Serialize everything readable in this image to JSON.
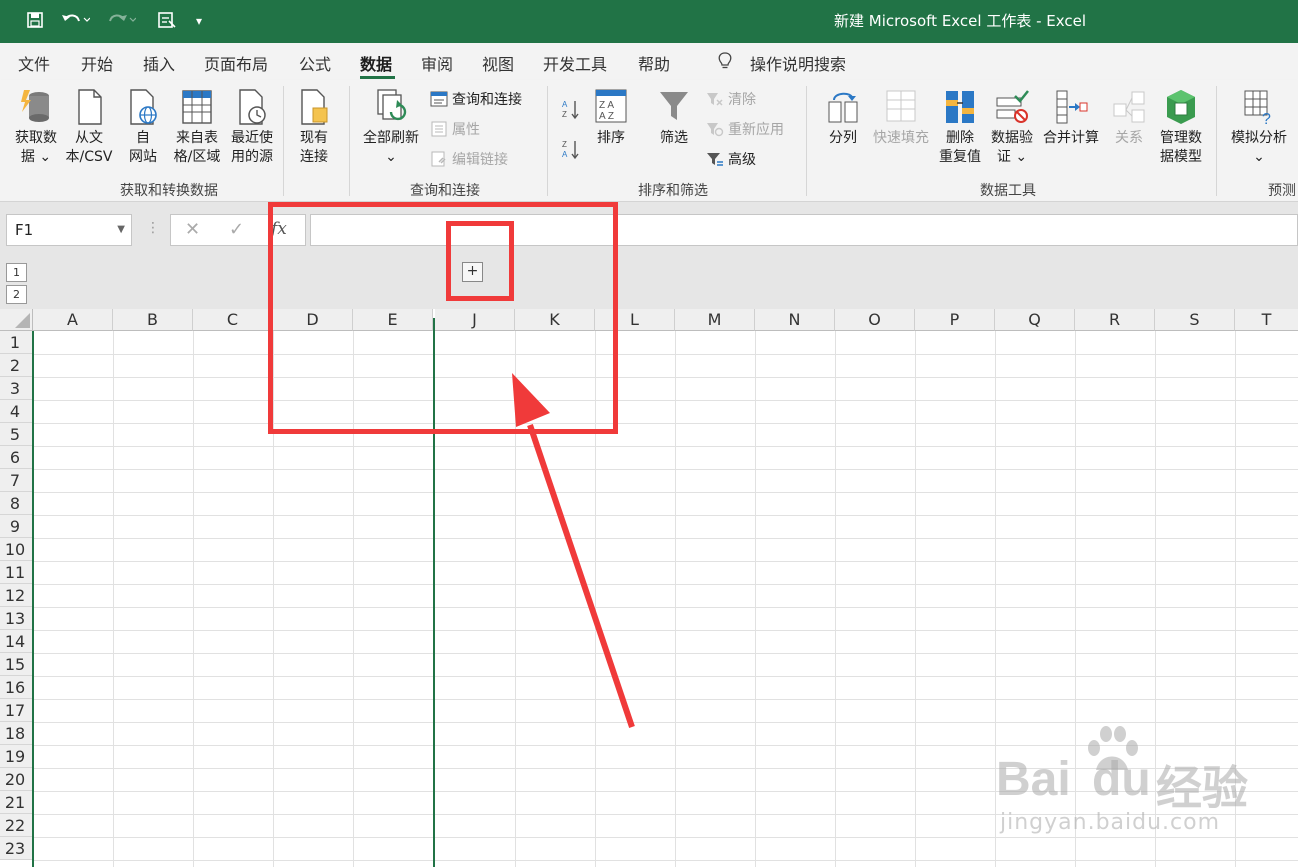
{
  "window": {
    "title": "新建 Microsoft Excel 工作表  -  Excel"
  },
  "quick_access": {
    "save": "save-icon",
    "undo": "undo-icon",
    "redo": "redo-icon",
    "form": "form-icon",
    "customize": "customize-icon"
  },
  "tabs": [
    "文件",
    "开始",
    "插入",
    "页面布局",
    "公式",
    "数据",
    "审阅",
    "视图",
    "开发工具",
    "帮助"
  ],
  "active_tab": "数据",
  "tell_me": "操作说明搜索",
  "ribbon": {
    "get_transform": {
      "label": "获取和转换数据",
      "get_data": [
        "获取数",
        "据 ⌄"
      ],
      "from_text": [
        "从文",
        "本/CSV"
      ],
      "from_web": [
        "自",
        "网站"
      ],
      "from_table": [
        "来自表",
        "格/区域"
      ],
      "recent": [
        "最近使",
        "用的源"
      ],
      "existing": [
        "现有",
        "连接"
      ]
    },
    "queries": {
      "label": "查询和连接",
      "refresh_all": [
        "全部刷新",
        "⌄"
      ],
      "queries_connections": "查询和连接",
      "properties": "属性",
      "edit_links": "编辑链接"
    },
    "sort_filter": {
      "label": "排序和筛选",
      "sort": "排序",
      "filter": "筛选",
      "clear": "清除",
      "reapply": "重新应用",
      "advanced": "高级"
    },
    "data_tools": {
      "label": "数据工具",
      "text_to_columns": "分列",
      "flash_fill": "快速填充",
      "remove_duplicates": [
        "删除",
        "重复值"
      ],
      "data_validation": [
        "数据验",
        "证 ⌄"
      ],
      "consolidate": "合并计算",
      "relationships": "关系",
      "data_model": [
        "管理数",
        "据模型"
      ]
    },
    "forecast": {
      "label": "预测",
      "what_if": [
        "模拟分析",
        "⌄"
      ]
    }
  },
  "formula_bar": {
    "name_box": "F1",
    "fx": "fx",
    "cancel": "✕",
    "enter": "✓",
    "formula": ""
  },
  "outline": {
    "levels": [
      "1",
      "2"
    ],
    "expand": "+"
  },
  "columns": [
    "A",
    "B",
    "C",
    "D",
    "E",
    "J",
    "K",
    "L",
    "M",
    "N",
    "O",
    "P",
    "Q",
    "R",
    "S",
    "T"
  ],
  "rows": [
    "1",
    "2",
    "3",
    "4",
    "5",
    "6",
    "7",
    "8",
    "9",
    "10",
    "11",
    "12",
    "13",
    "14",
    "15",
    "16",
    "17",
    "18",
    "19",
    "20",
    "21",
    "22",
    "23"
  ],
  "watermark": {
    "brand": "Bai",
    "brand2": "du",
    "cn": "经验",
    "url": "jingyan.baidu.com"
  },
  "colors": {
    "excel_green": "#217346",
    "annotation_red": "#f03a3a"
  }
}
